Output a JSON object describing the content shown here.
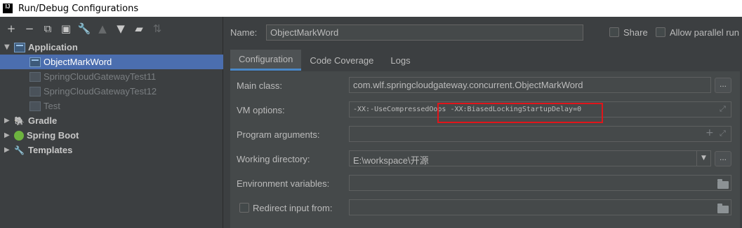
{
  "window": {
    "title": "Run/Debug Configurations",
    "logo": "IJ"
  },
  "toolbar": {
    "icons": [
      "add-icon",
      "remove-icon",
      "copy-icon",
      "save-icon",
      "wrench-icon",
      "move-up-icon",
      "move-down-icon",
      "new-folder-icon",
      "sort-icon"
    ]
  },
  "tree": {
    "application": {
      "label": "Application",
      "expanded": true
    },
    "items": [
      {
        "label": "ObjectMarkWord",
        "selected": true
      },
      {
        "label": "SpringCloudGatewayTest11"
      },
      {
        "label": "SpringCloudGatewayTest12"
      },
      {
        "label": "Test"
      }
    ],
    "gradle": {
      "label": "Gradle"
    },
    "spring_boot": {
      "label": "Spring Boot"
    },
    "templates": {
      "label": "Templates"
    }
  },
  "header": {
    "name_label": "Name:",
    "name_value": "ObjectMarkWord",
    "share_label": "Share",
    "parallel_label": "Allow parallel run"
  },
  "tabs": [
    {
      "label": "Configuration",
      "active": true
    },
    {
      "label": "Code Coverage"
    },
    {
      "label": "Logs"
    }
  ],
  "config": {
    "main_class_label": "Main class:",
    "main_class_value": "com.wlf.springcloudgateway.concurrent.ObjectMarkWord",
    "vm_options_label": "VM options:",
    "vm_options_value": "-XX:-UseCompressedOops -XX:BiasedLockingStartupDelay=0",
    "program_args_label": "Program arguments:",
    "program_args_value": "",
    "working_dir_label": "Working directory:",
    "working_dir_value": "E:\\workspace\\开源",
    "env_vars_label": "Environment variables:",
    "env_vars_value": "",
    "redirect_label": "Redirect input from:",
    "redirect_value": "",
    "browse_label": "..."
  },
  "colors": {
    "background": "#3c3f41",
    "selection": "#4b6eaf",
    "tab_underline": "#4a88c7",
    "highlight_box": "#e0151a"
  }
}
